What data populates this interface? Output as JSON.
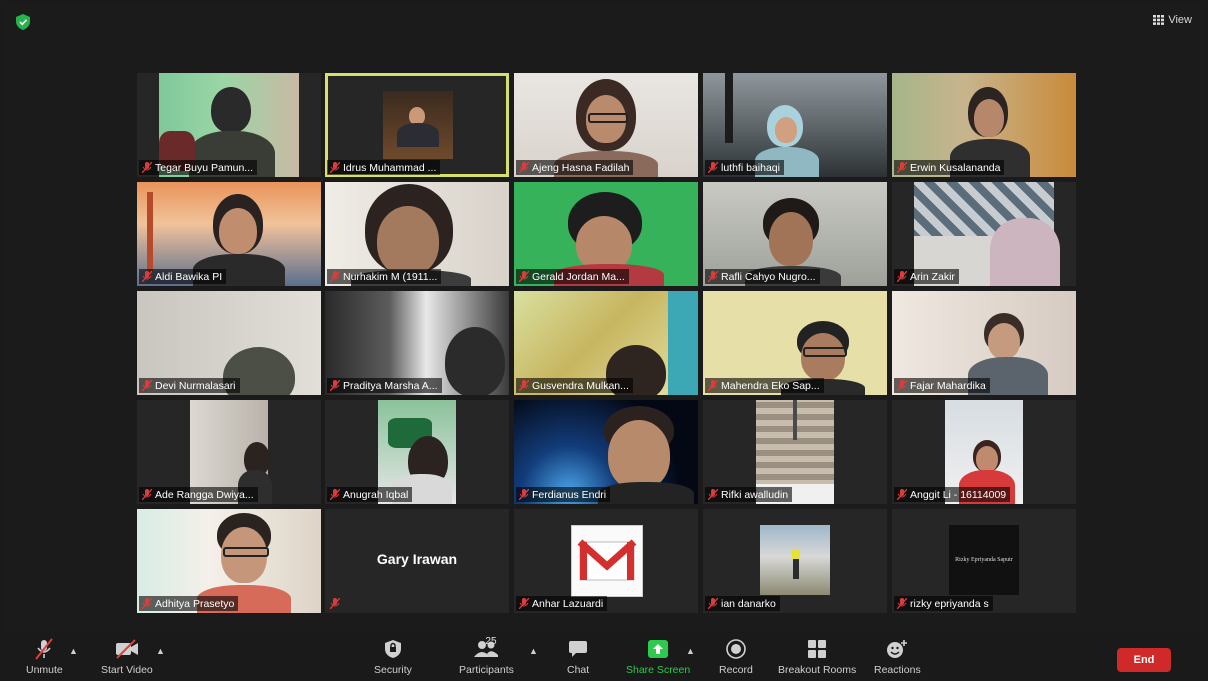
{
  "top": {
    "view_label": "View"
  },
  "participants": [
    {
      "name": "Tegar Buyu Pamun..."
    },
    {
      "name": "Idrus Muhammad ..."
    },
    {
      "name": "Ajeng Hasna Fadilah"
    },
    {
      "name": "luthfi baihaqi"
    },
    {
      "name": "Erwin Kusalananda"
    },
    {
      "name": "Aldi Bawika PI"
    },
    {
      "name": "Nurhakim M (1911..."
    },
    {
      "name": "Gerald Jordan Ma..."
    },
    {
      "name": "Rafli Cahyo Nugro..."
    },
    {
      "name": "Arin Zakir"
    },
    {
      "name": "Devi Nurmalasari"
    },
    {
      "name": "Praditya Marsha A..."
    },
    {
      "name": "Gusvendra Mulkan..."
    },
    {
      "name": "Mahendra Eko Sap..."
    },
    {
      "name": "Fajar Mahardika"
    },
    {
      "name": "Ade Rangga Dwiya..."
    },
    {
      "name": "Anugrah Iqbal"
    },
    {
      "name": "Ferdianus Endri"
    },
    {
      "name": "Rifki awalludin"
    },
    {
      "name": "Anggit Li - 16114009"
    },
    {
      "name": "Adhitya Prasetyo"
    },
    {
      "name": "Gary Irawan"
    },
    {
      "name": "Anhar Lazuardi"
    },
    {
      "name": "ian danarko"
    },
    {
      "name": "rizky epriyanda s"
    }
  ],
  "rizky_card_text": "Rizky Epriyanda Saputr",
  "toolbar": {
    "unmute": "Unmute",
    "start_video": "Start Video",
    "security": "Security",
    "participants": "Participants",
    "participants_count": "25",
    "chat": "Chat",
    "share_screen": "Share Screen",
    "record": "Record",
    "breakout_rooms": "Breakout Rooms",
    "reactions": "Reactions",
    "end": "End"
  },
  "colors": {
    "active_speaker": "#d6e06a",
    "end_button": "#d0292a",
    "share_green": "#2ccb4e",
    "muted_red": "#e03b3b"
  }
}
